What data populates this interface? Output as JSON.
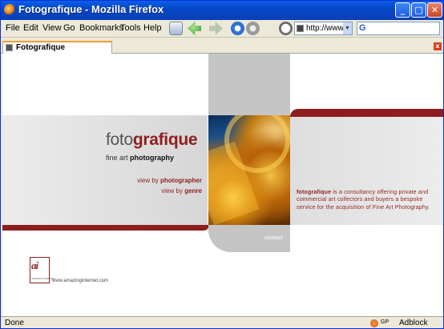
{
  "window": {
    "title": "Fotografique - Mozilla Firefox",
    "minimize_glyph": "_",
    "maximize_glyph": "□",
    "close_glyph": "✕"
  },
  "menu": {
    "items": [
      "File",
      "Edit",
      "View",
      "Go",
      "Bookmarks",
      "Tools",
      "Help"
    ]
  },
  "toolbar": {
    "icons": [
      "mail-icon",
      "back-icon",
      "forward-icon",
      "reload-icon",
      "stop-icon",
      "history-icon"
    ],
    "url": "http://www",
    "search_logo": "G"
  },
  "tab": {
    "title": "Fotografique",
    "close_glyph": "x"
  },
  "page": {
    "logo_light": "foto",
    "logo_bold": "grafique",
    "tagline_light": "fine art ",
    "tagline_bold": "photography",
    "link_photographer_prefix": "view by ",
    "link_photographer": "photographer",
    "link_genre_prefix": "view by ",
    "link_genre": "genre",
    "desc_bold": "fotografique",
    "desc_text": " is a consultancy offering private and commercial art collectors and buyers a bespoke service for the acquisition of Fine Art Photography.",
    "contact": "contact",
    "ai_logo_letters": "ai",
    "ai_logo_sub": "AMAZING INTERNET",
    "credit": "www.amazinginternet.com"
  },
  "colors": {
    "brand_red": "#8e1e1e",
    "xp_blue": "#0a5fe8"
  },
  "status": {
    "text": "Done",
    "gp": "GP",
    "adblock": "Adblock"
  }
}
